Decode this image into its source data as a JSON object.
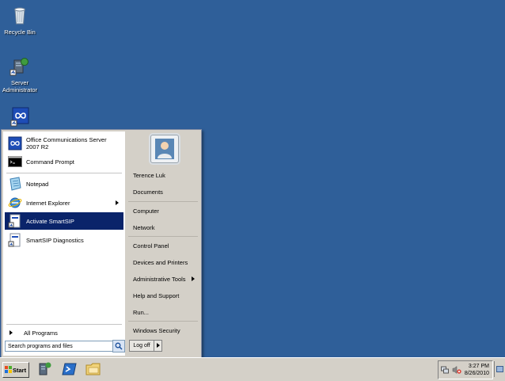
{
  "desktop": {
    "icons": [
      {
        "label": "Recycle Bin",
        "icon": "recycle-bin-icon"
      },
      {
        "label": "Server Administrator",
        "icon": "server-admin-icon"
      },
      {
        "label": "",
        "icon": "smartsip-icon"
      }
    ]
  },
  "start_menu": {
    "programs": [
      {
        "label": "Office Communications Server 2007 R2",
        "icon": "ocs-icon"
      },
      {
        "label": "Command Prompt",
        "icon": "cmd-icon"
      },
      {
        "label": "Notepad",
        "icon": "notepad-icon"
      },
      {
        "label": "Internet Explorer",
        "icon": "ie-icon"
      },
      {
        "label": "Activate SmartSIP",
        "icon": "smartsip-shortcut-icon"
      },
      {
        "label": "SmartSIP Diagnostics",
        "icon": "smartsip-diag-icon"
      }
    ],
    "all_programs": "All Programs",
    "search_placeholder": "Search programs and files",
    "right_items": [
      "Terence Luk",
      "Documents",
      "Computer",
      "Network",
      "Control Panel",
      "Devices and Printers",
      "Administrative Tools",
      "Help and Support",
      "Run...",
      "Windows Security"
    ],
    "logoff": "Log off"
  },
  "taskbar": {
    "start_label": "Start",
    "time": "3:27 PM",
    "date": "8/26/2010"
  },
  "colors": {
    "desktop": "#2f5f99",
    "selected": "#0a246a"
  }
}
